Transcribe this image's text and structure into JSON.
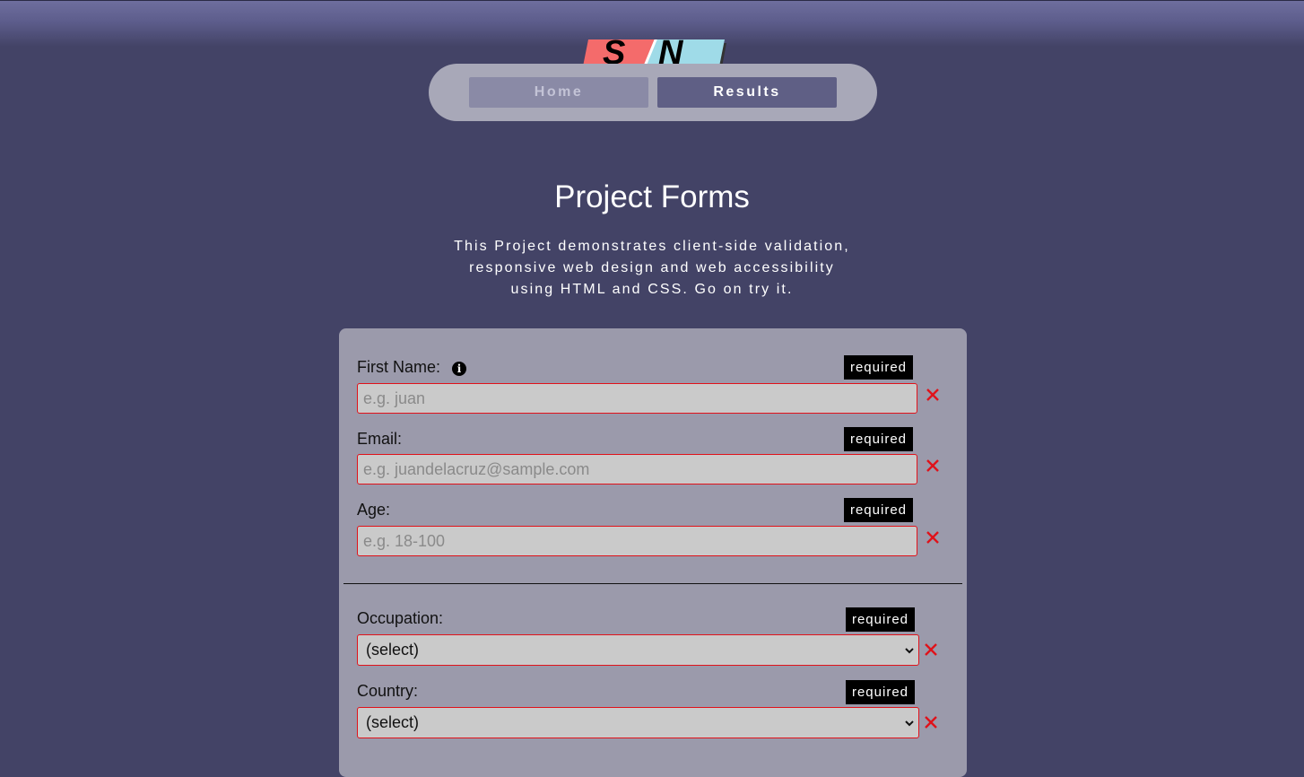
{
  "logo": {
    "text_left": "S",
    "text_right": "N",
    "colors": {
      "left": "#f46b6b",
      "right": "#9fdbe8",
      "shadow": "#333333"
    }
  },
  "nav": {
    "items": [
      {
        "label": "Home"
      },
      {
        "label": "Results"
      }
    ]
  },
  "page": {
    "title": "Project Forms",
    "intro_lines": [
      "This Project demonstrates client-side validation,",
      "responsive web design and web accessibility",
      "using HTML and CSS. Go on try it."
    ]
  },
  "form": {
    "required_label": "required",
    "fields": [
      {
        "label": "First Name:",
        "placeholder": "e.g. juan",
        "value": "",
        "info_icon": "info-icon",
        "status": "invalid"
      },
      {
        "label": "Email:",
        "placeholder": "e.g. juandelacruz@sample.com",
        "value": "",
        "status": "invalid"
      },
      {
        "label": "Age:",
        "placeholder": "e.g. 18-100",
        "value": "",
        "status": "invalid"
      }
    ],
    "selects": [
      {
        "label": "Occupation:",
        "selected": "(select)",
        "status": "invalid"
      },
      {
        "label": "Country:",
        "selected": "(select)",
        "status": "invalid"
      }
    ],
    "invalid_icon": "close-icon",
    "colors": {
      "invalid": "#e0121a",
      "card": "#9b9aab",
      "background": "#434366"
    }
  }
}
